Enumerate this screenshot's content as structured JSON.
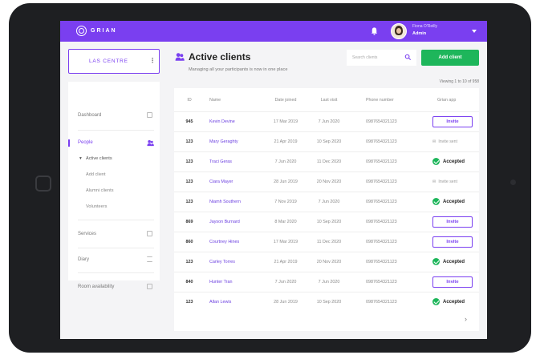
{
  "app": {
    "logo_text": "GRIAN",
    "user_name": "Fiona O'Reilly",
    "user_role": "Admin"
  },
  "colors": {
    "brand": "#7a3ff0",
    "success": "#1eb65b",
    "bezel": "#1e1f22"
  },
  "sidebar": {
    "centre_name": "LAS CENTRE",
    "items": [
      {
        "label": "Dashboard",
        "icon": "dashboard-icon"
      },
      {
        "label": "People",
        "icon": "people-icon",
        "active": true
      },
      {
        "label": "Services",
        "icon": "services-icon"
      },
      {
        "label": "Diary",
        "icon": "diary-icon"
      },
      {
        "label": "Room availability",
        "icon": "room-icon"
      }
    ],
    "people_sub": [
      "Active clients",
      "Add client",
      "Alumni clients",
      "Volunteers"
    ]
  },
  "main": {
    "title": "Active clients",
    "subtitle": "Managing all your participants is now in one place",
    "search_placeholder": "Search clients",
    "add_button": "Add client",
    "viewing": "Viewing 1 to 10 of 958"
  },
  "table": {
    "headers": [
      "ID",
      "Name",
      "Date joined",
      "Last visit",
      "Phone number",
      "Grian app"
    ],
    "rows": [
      {
        "id": "945",
        "name": "Kevin Devine",
        "joined": "17 Mar 2019",
        "last": "7 Jun 2020",
        "phone": "0987654321123",
        "app": "Invite"
      },
      {
        "id": "123",
        "name": "Mary Geraghty",
        "joined": "21 Apr 2019",
        "last": "10 Sep 2020",
        "phone": "0987654321123",
        "app": "Invite sent"
      },
      {
        "id": "123",
        "name": "Traci Geras",
        "joined": "7 Jun 2020",
        "last": "11 Dec 2020",
        "phone": "0987654321123",
        "app": "Accepted"
      },
      {
        "id": "123",
        "name": "Ciara Mayer",
        "joined": "28 Jun 2019",
        "last": "20 Nov 2020",
        "phone": "0987654321123",
        "app": "Invite sent"
      },
      {
        "id": "123",
        "name": "Niamh Southern",
        "joined": "7 Nov 2019",
        "last": "7 Jun 2020",
        "phone": "0987654321123",
        "app": "Accepted"
      },
      {
        "id": "869",
        "name": "Jayson Burnard",
        "joined": "8 Mar 2020",
        "last": "10 Sep 2020",
        "phone": "0987654321123",
        "app": "Invite"
      },
      {
        "id": "860",
        "name": "Courtney Hines",
        "joined": "17 Mar 2019",
        "last": "11 Dec 2020",
        "phone": "0987654321123",
        "app": "Invite"
      },
      {
        "id": "123",
        "name": "Carley Torres",
        "joined": "21 Apr 2019",
        "last": "20 Nov 2020",
        "phone": "0987654321123",
        "app": "Accepted"
      },
      {
        "id": "840",
        "name": "Hunter Tran",
        "joined": "7 Jun 2020",
        "last": "7 Jun 2020",
        "phone": "0987654321123",
        "app": "Invite"
      },
      {
        "id": "123",
        "name": "Allan Lewis",
        "joined": "28 Jun 2019",
        "last": "10 Sep 2020",
        "phone": "0987654321123",
        "app": "Accepted"
      }
    ],
    "next_glyph": "›"
  }
}
